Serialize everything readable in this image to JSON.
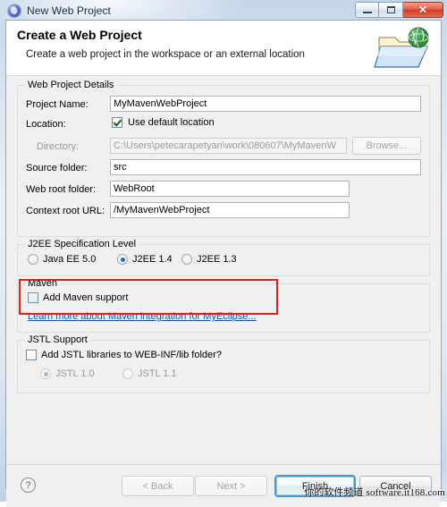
{
  "window": {
    "title": "New Web Project",
    "icon": "myeclipse-icon",
    "buttons": {
      "minimize": "minimize",
      "maximize": "maximize",
      "close": "✕"
    }
  },
  "banner": {
    "title": "Create a Web Project",
    "subtitle": "Create a web project in the workspace or an external location",
    "icon": "web-folder-globe-icon"
  },
  "groups": {
    "web_project_details": {
      "legend": "Web Project Details",
      "fields": {
        "project_name_label": "Project Name:",
        "project_name_value": "MyMavenWebProject",
        "location_label": "Location:",
        "use_default_location_label": "Use default location",
        "use_default_location_checked": true,
        "directory_label": "Directory:",
        "directory_value": "C:\\Users\\petecarapetyan\\work\\080607\\MyMavenW",
        "browse_label": "Browse...",
        "source_folder_label": "Source folder:",
        "source_folder_value": "src",
        "web_root_folder_label": "Web root folder:",
        "web_root_folder_value": "WebRoot",
        "context_root_url_label": "Context root URL:",
        "context_root_url_value": "/MyMavenWebProject"
      }
    },
    "j2ee_spec": {
      "legend": "J2EE Specification Level",
      "options": [
        {
          "label": "Java EE 5.0",
          "selected": false
        },
        {
          "label": "J2EE 1.4",
          "selected": true
        },
        {
          "label": "J2EE 1.3",
          "selected": false
        }
      ]
    },
    "maven": {
      "legend": "Maven",
      "add_maven_support_label": "Add Maven support",
      "add_maven_support_checked": false,
      "link_label": "Learn more about Maven integration for MyEclipse...",
      "highlight_color": "#e02020"
    },
    "jstl": {
      "legend": "JSTL Support",
      "add_jstl_label": "Add JSTL libraries to WEB-INF/lib folder?",
      "add_jstl_checked": false,
      "options": [
        {
          "label": "JSTL 1.0",
          "selected": true,
          "disabled": true
        },
        {
          "label": "JSTL 1.1",
          "selected": false,
          "disabled": true
        }
      ]
    }
  },
  "footer": {
    "help": "?",
    "back_label": "< Back",
    "next_label": "Next >",
    "finish_label": "Finish",
    "cancel_label": "Cancel"
  },
  "watermark": {
    "cn": "你的软件频道",
    "en": "software.it168.com"
  }
}
